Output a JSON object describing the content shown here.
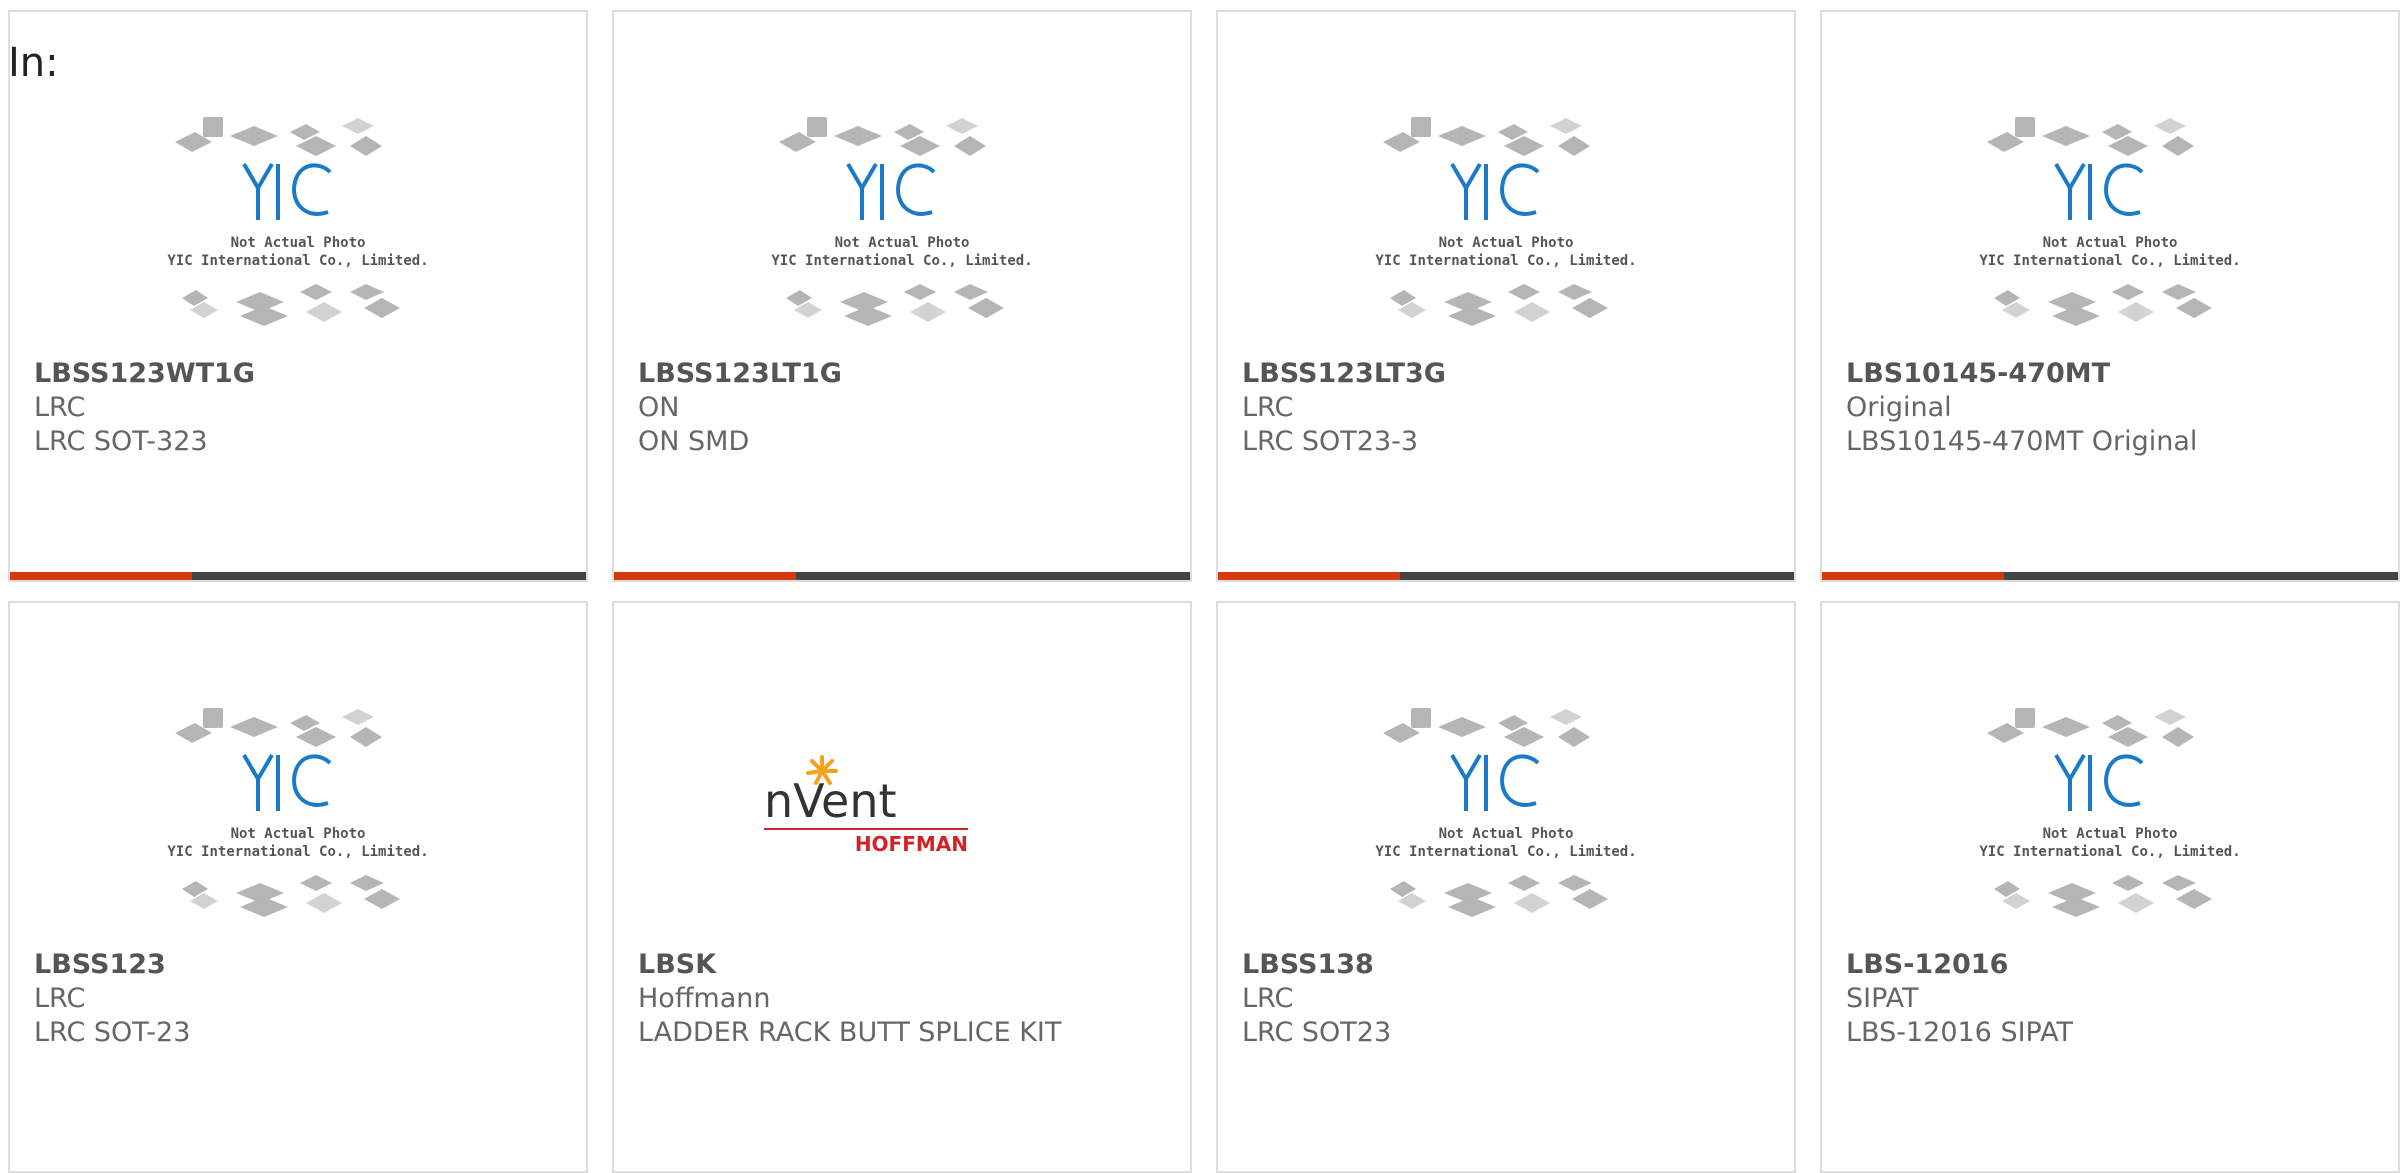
{
  "page": {
    "in_label": "In:"
  },
  "placeholder": {
    "line1": "Not Actual Photo",
    "line2": "YIC International Co., Limited.",
    "logo_text": "YIC"
  },
  "nvent_logo": {
    "brand": "nVent",
    "sub": "HOFFMAN"
  },
  "colors": {
    "accent": "#d63a0a",
    "bar": "#444444",
    "logo_blue": "#1a7ac8",
    "nvent_red": "#d3222a"
  },
  "products": [
    {
      "part": "LBSS123WT1G",
      "mfr": "LRC",
      "desc": "LRC SOT-323",
      "image": "yic-placeholder",
      "bar": true
    },
    {
      "part": "LBSS123LT1G",
      "mfr": "ON",
      "desc": "ON SMD",
      "image": "yic-placeholder",
      "bar": true
    },
    {
      "part": "LBSS123LT3G",
      "mfr": "LRC",
      "desc": "LRC SOT23-3",
      "image": "yic-placeholder",
      "bar": true
    },
    {
      "part": "LBS10145-470MT",
      "mfr": "Original",
      "desc": "LBS10145-470MT Original",
      "image": "yic-placeholder",
      "bar": true
    },
    {
      "part": "LBSS123",
      "mfr": "LRC",
      "desc": "LRC SOT-23",
      "image": "yic-placeholder",
      "bar": false
    },
    {
      "part": "LBSK",
      "mfr": "Hoffmann",
      "desc": "LADDER RACK BUTT SPLICE KIT",
      "image": "nvent-logo",
      "bar": false
    },
    {
      "part": "LBSS138",
      "mfr": "LRC",
      "desc": "LRC SOT23",
      "image": "yic-placeholder",
      "bar": false
    },
    {
      "part": "LBS-12016",
      "mfr": "SIPAT",
      "desc": "LBS-12016 SIPAT",
      "image": "yic-placeholder",
      "bar": false
    }
  ]
}
